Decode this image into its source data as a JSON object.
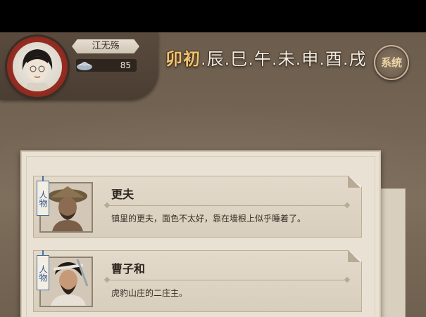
{
  "player": {
    "name": "江无殇",
    "silver": "85"
  },
  "time": {
    "current": "卯初",
    "periods": [
      "辰",
      "巳",
      "午",
      "未",
      "申",
      "酉",
      "戌"
    ]
  },
  "system_button": {
    "label": "系统"
  },
  "characters": [
    {
      "tag": "人物",
      "name": "更夫",
      "description": "镇里的更夫，面色不太好，靠在墙根上似乎睡着了。"
    },
    {
      "tag": "人物",
      "name": "曹子和",
      "description": "虎豹山庄的二庄主。"
    }
  ],
  "colors": {
    "current_time": "#f2c26b",
    "tag_blue": "#2f568a",
    "avatar_ring": "#b33a2c"
  }
}
